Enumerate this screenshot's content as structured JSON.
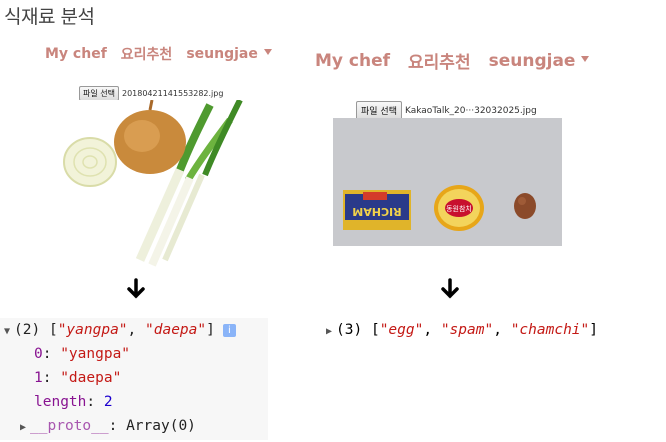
{
  "page": {
    "heading": "식재료 분석"
  },
  "left_panel": {
    "nav": {
      "brand": "My chef",
      "recipe": "요리추천",
      "user": "seungjae"
    },
    "file_input": {
      "button_label": "파일 선택",
      "file_name": "20180421141553282.jpg"
    },
    "photo": {
      "icon": "onion-scallion-photo"
    }
  },
  "right_panel": {
    "nav": {
      "brand": "My chef",
      "recipe": "요리추천",
      "user": "seungjae"
    },
    "file_input": {
      "button_label": "파일 선택",
      "file_name": "KakaoTalk_20···32032025.jpg"
    },
    "photo": {
      "icon": "spam-tuna-egg-photo",
      "spam_label": "RICHAM",
      "tuna_label": "동원참치"
    }
  },
  "arrows": {
    "glyph": "🡇",
    "icon": "down-arrow-icon"
  },
  "console_left": {
    "summary": {
      "count": "(2)",
      "open_bracket": "[",
      "item_0": "\"yangpa\"",
      "sep": ", ",
      "item_1": "\"daepa\"",
      "close_bracket": "]",
      "info": "i"
    },
    "entries": [
      {
        "key": "0",
        "value": "\"yangpa\""
      },
      {
        "key": "1",
        "value": "\"daepa\""
      }
    ],
    "length": {
      "key": "length",
      "value": "2"
    },
    "proto": {
      "key": "__proto__",
      "value": "Array(0)"
    }
  },
  "console_right": {
    "summary": {
      "count": "(3)",
      "open_bracket": "[",
      "item_0": "\"egg\"",
      "item_1": "\"spam\"",
      "item_2": "\"chamchi\"",
      "sep": ", ",
      "close_bracket": "]"
    }
  }
}
